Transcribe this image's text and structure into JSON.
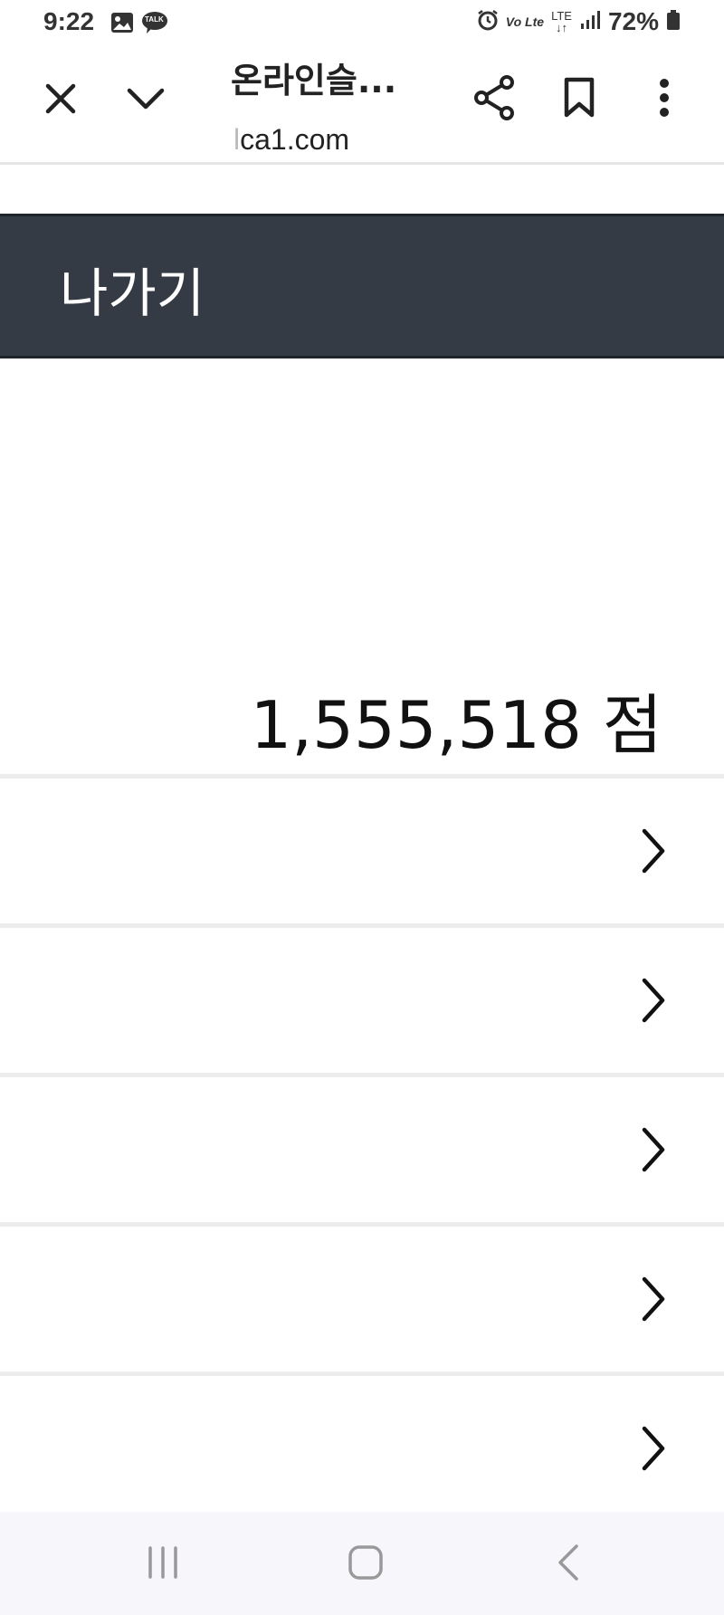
{
  "status_bar": {
    "time": "9:22",
    "left_icons": [
      "image-icon",
      "kakaotalk-icon"
    ],
    "kakaotalk_badge": "TALK",
    "right_icons": [
      "alarm-icon",
      "volte-icon",
      "lte-icon",
      "signal-icon"
    ],
    "volte_label": "Vo Lte",
    "lte_label": "LTE",
    "battery_percent": "72%"
  },
  "toolbar": {
    "title": "온라인슬...",
    "url_prefix": "l",
    "url": "ca1.com",
    "buttons": [
      "close-icon",
      "chevron-down-icon",
      "share-icon",
      "bookmark-icon",
      "more-vert-icon"
    ]
  },
  "exit_bar": {
    "label": "나가기",
    "background": "#343b45"
  },
  "score": {
    "text": "1,555,518 점"
  },
  "list": {
    "rows": 5,
    "row_icon": "chevron-right-icon"
  },
  "nav_bar": {
    "buttons": [
      "recent-apps-icon",
      "home-icon",
      "back-icon"
    ]
  }
}
